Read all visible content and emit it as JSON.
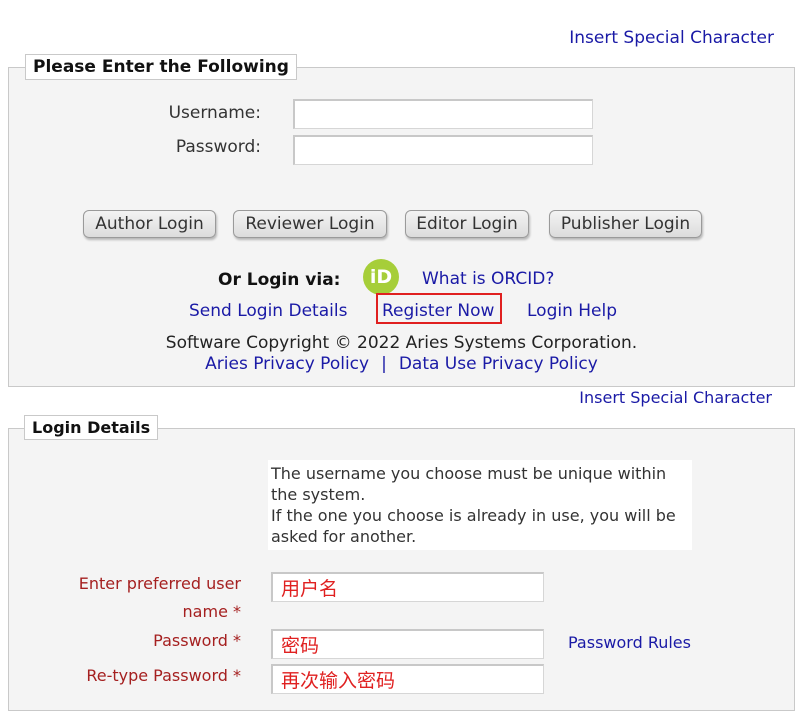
{
  "top_link": "Insert Special Character",
  "login_panel": {
    "legend": "Please Enter the Following",
    "username_label": "Username:",
    "password_label": "Password:",
    "buttons": {
      "author": "Author Login",
      "reviewer": "Reviewer Login",
      "editor": "Editor Login",
      "publisher": "Publisher Login"
    },
    "orcid_label": "Or Login via:",
    "orcid_icon_text": "iD",
    "orcid_color": "#a6ce39",
    "what_orcid": "What is ORCID?",
    "send_login": "Send Login Details",
    "register": "Register Now",
    "login_help": "Login Help",
    "copyright": "Software Copyright © 2022 Aries Systems Corporation.",
    "privacy_policy": "Aries Privacy Policy",
    "separator": "|",
    "data_policy": "Data Use Privacy Policy"
  },
  "second_link": "Insert Special Character",
  "details_panel": {
    "legend": "Login Details",
    "info_line1": "The username you choose must be unique within",
    "info_line2": "the system.",
    "info_line3": "If the one you choose is already in use, you will be",
    "info_line4": "asked for another.",
    "pref_user_line1": "Enter preferred user",
    "pref_user_line2": "name *",
    "pref_user_value": "用户名",
    "password_label": "Password *",
    "password_value": "密码",
    "password_rules": "Password Rules",
    "retype_label": "Re-type Password *",
    "retype_value": "再次输入密码"
  },
  "colors": {
    "link": "#1a1aa6",
    "highlight_border": "#e02020",
    "required_label": "#a52020"
  }
}
